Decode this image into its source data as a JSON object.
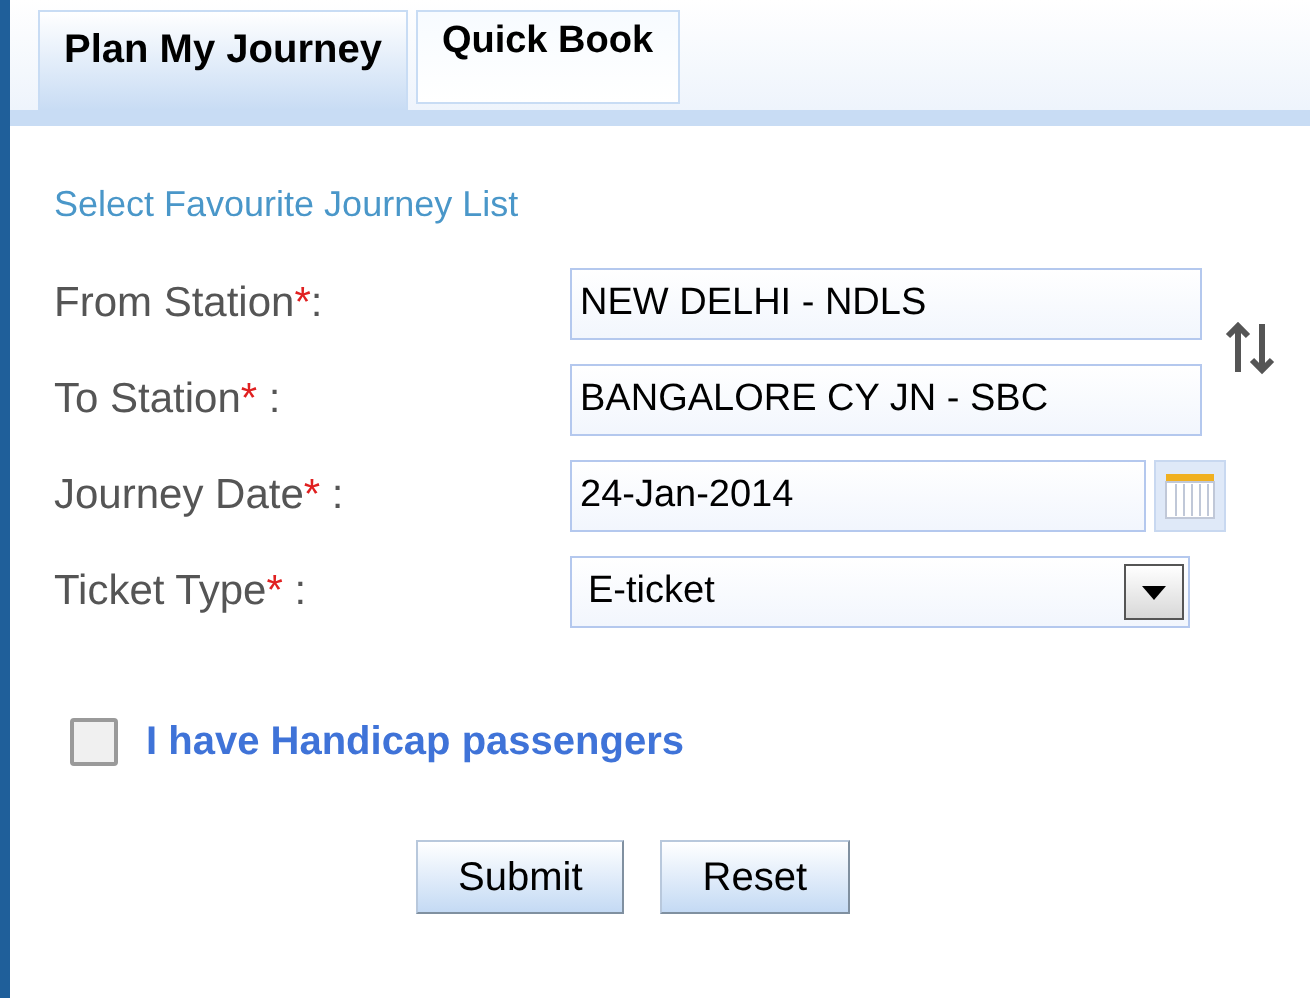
{
  "tabs": [
    {
      "label": "Plan My Journey",
      "selected": true
    },
    {
      "label": "Quick Book",
      "selected": false
    }
  ],
  "favourite_link": "Select Favourite Journey List",
  "fields": [
    {
      "kind": "text",
      "label": "From Station",
      "required_mark": "*",
      "colon": ":",
      "value": "NEW DELHI - NDLS"
    },
    {
      "kind": "text",
      "label": "To Station",
      "required_mark": "*",
      "colon": " :",
      "value": "BANGALORE CY JN - SBC"
    },
    {
      "kind": "date",
      "label": "Journey Date",
      "required_mark": "*",
      "colon": " :",
      "value": "24-Jan-2014"
    },
    {
      "kind": "select",
      "label": "Ticket Type",
      "required_mark": "*",
      "colon": " :",
      "value": "E-ticket"
    }
  ],
  "handicap": {
    "label": "I have Handicap passengers",
    "checked": false
  },
  "buttons": [
    "Submit",
    "Reset"
  ]
}
